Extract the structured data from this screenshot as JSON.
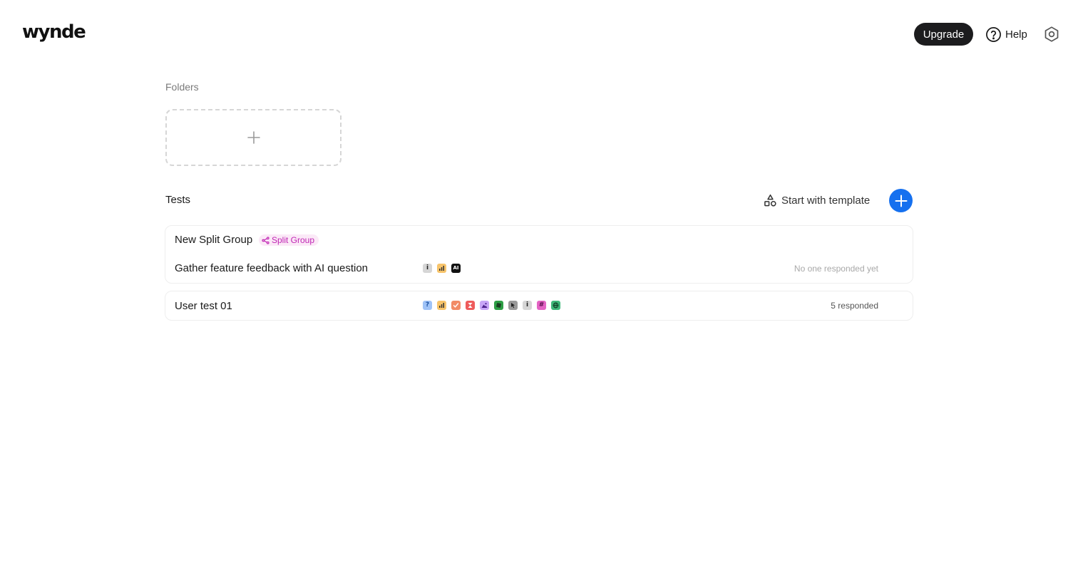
{
  "header": {
    "logo": "wynde",
    "upgrade_label": "Upgrade",
    "help_label": "Help"
  },
  "folders": {
    "label": "Folders"
  },
  "tests": {
    "label": "Tests",
    "template_label": "Start with template",
    "items": [
      {
        "title": "New Split Group",
        "badge": "Split Group"
      },
      {
        "title": "Gather feature feedback with AI question",
        "status": "No one responded yet",
        "question_icons": [
          "info-icon",
          "bar-chart-icon",
          "ai-icon"
        ]
      },
      {
        "title": "User test 01",
        "status": "5 responded",
        "question_icons": [
          "question-icon",
          "bar-chart-icon",
          "checkmark-icon",
          "hourglass-icon",
          "image-icon",
          "card-sort-icon",
          "cursor-icon",
          "info-icon",
          "hash-icon",
          "globe-icon"
        ]
      }
    ]
  },
  "colors": {
    "primary": "#1570ef",
    "upgrade_bg": "#1c1c1e",
    "badge_text": "#c026b4",
    "badge_bg": "#fbe9f7"
  }
}
